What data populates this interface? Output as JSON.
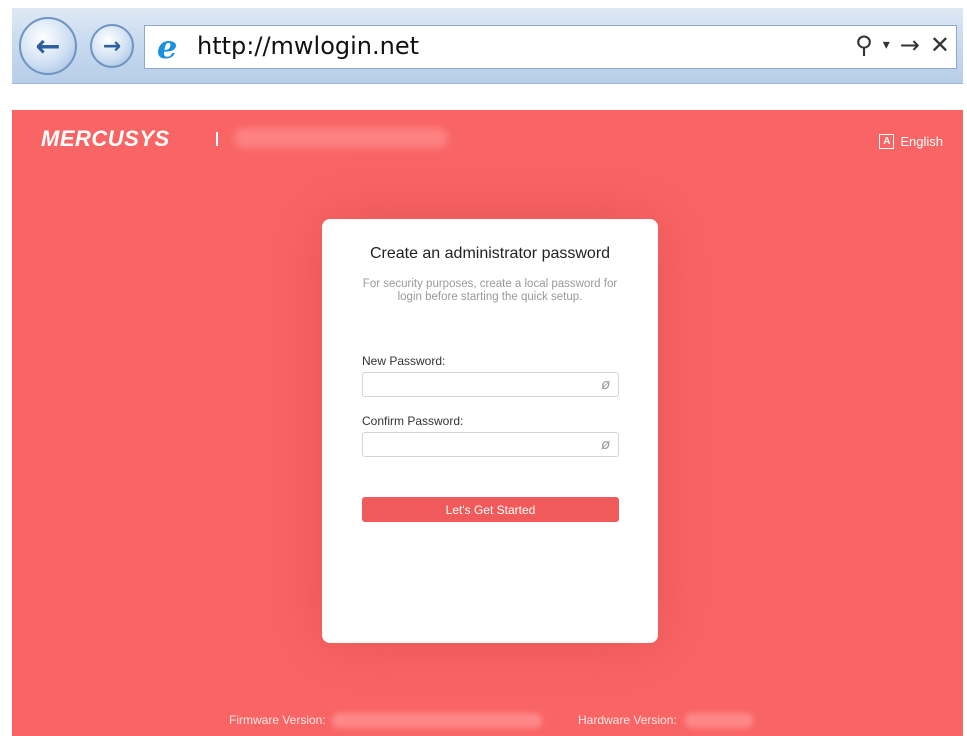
{
  "browser": {
    "url": "http://mwlogin.net",
    "back_glyph": "←",
    "forward_glyph": "→",
    "search_glyph": "⚲",
    "dropdown_glyph": "▾",
    "go_glyph": "→",
    "stop_glyph": "✕",
    "ie_glyph": "e"
  },
  "header": {
    "brand": "MERCUSYS",
    "language_icon": "A",
    "language": "English"
  },
  "card": {
    "title": "Create an administrator password",
    "description": "For security purposes, create a local password for login before starting the quick setup.",
    "new_password_label": "New Password:",
    "new_password_value": "",
    "confirm_password_label": "Confirm Password:",
    "confirm_password_value": "",
    "eye_glyph": "ø",
    "submit_label": "Let's Get Started"
  },
  "footer": {
    "firmware_label": "Firmware Version:",
    "hardware_label": "Hardware Version:"
  },
  "colors": {
    "page_background": "#f96464",
    "button": "#f05a5a",
    "card": "#ffffff"
  }
}
